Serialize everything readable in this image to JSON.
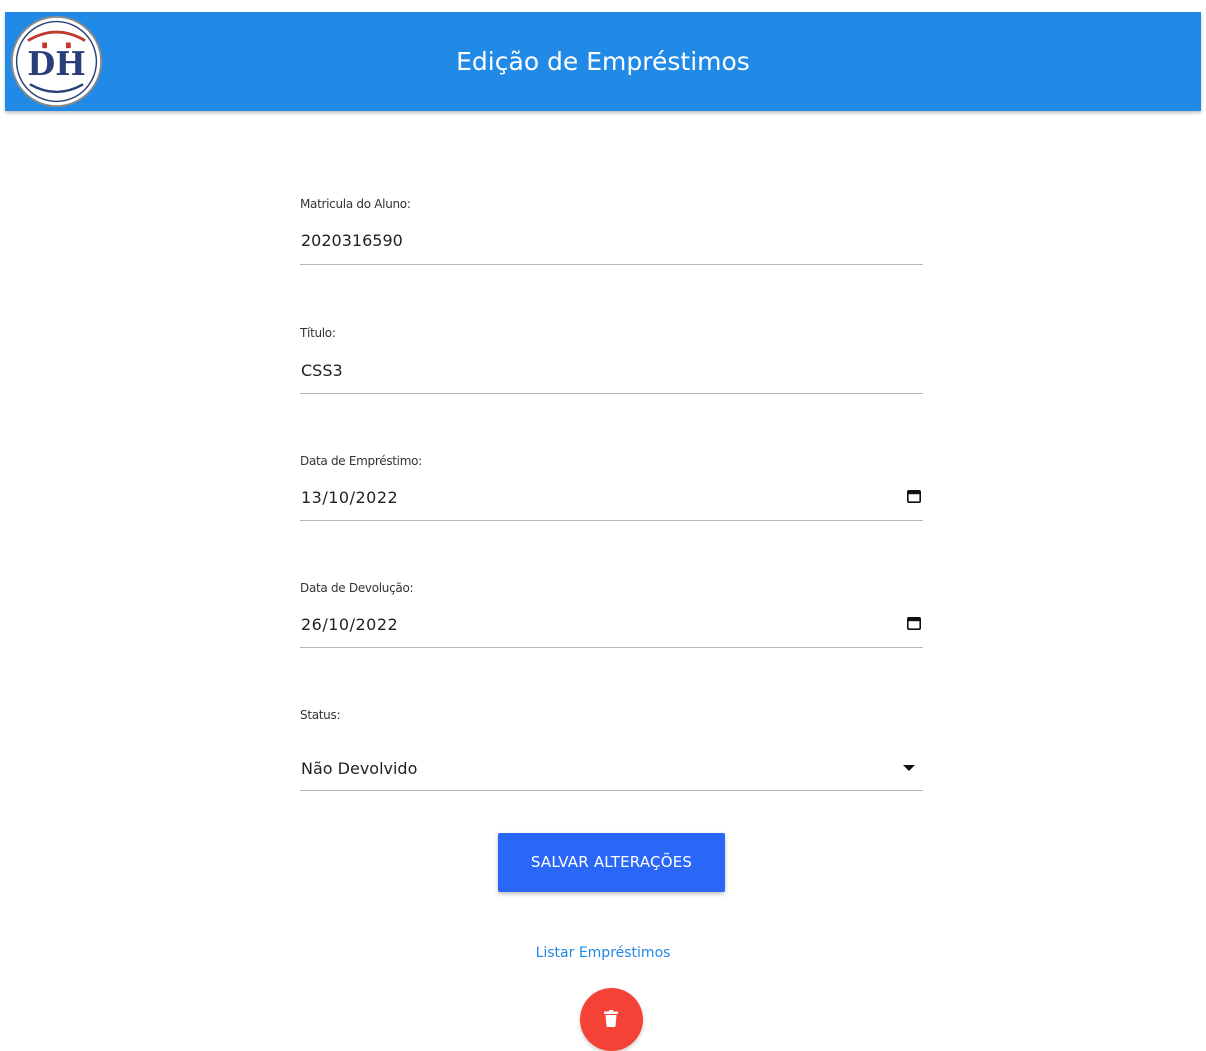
{
  "header": {
    "title": "Edição de Empréstimos",
    "logo_text": "DH",
    "background_color": "#2189e6"
  },
  "form": {
    "matricula": {
      "label": "Matricula do Aluno:",
      "value": "2020316590"
    },
    "titulo": {
      "label": "Título:",
      "value": "CSS3"
    },
    "data_emprestimo": {
      "label": "Data de Empréstimo:",
      "value": "13/10/2022",
      "icon": "calendar-icon"
    },
    "data_devolucao": {
      "label": "Data de Devolução:",
      "value": "26/10/2022",
      "icon": "calendar-icon"
    },
    "status": {
      "label": "Status:",
      "selected": "Não Devolvido",
      "icon": "dropdown-arrow-icon"
    }
  },
  "actions": {
    "save_label": "SALVAR ALTERAÇÕES",
    "save_color": "#2b67f6",
    "list_link_label": "Listar Empréstimos",
    "delete_icon": "trash-icon",
    "delete_color": "#f44336"
  }
}
